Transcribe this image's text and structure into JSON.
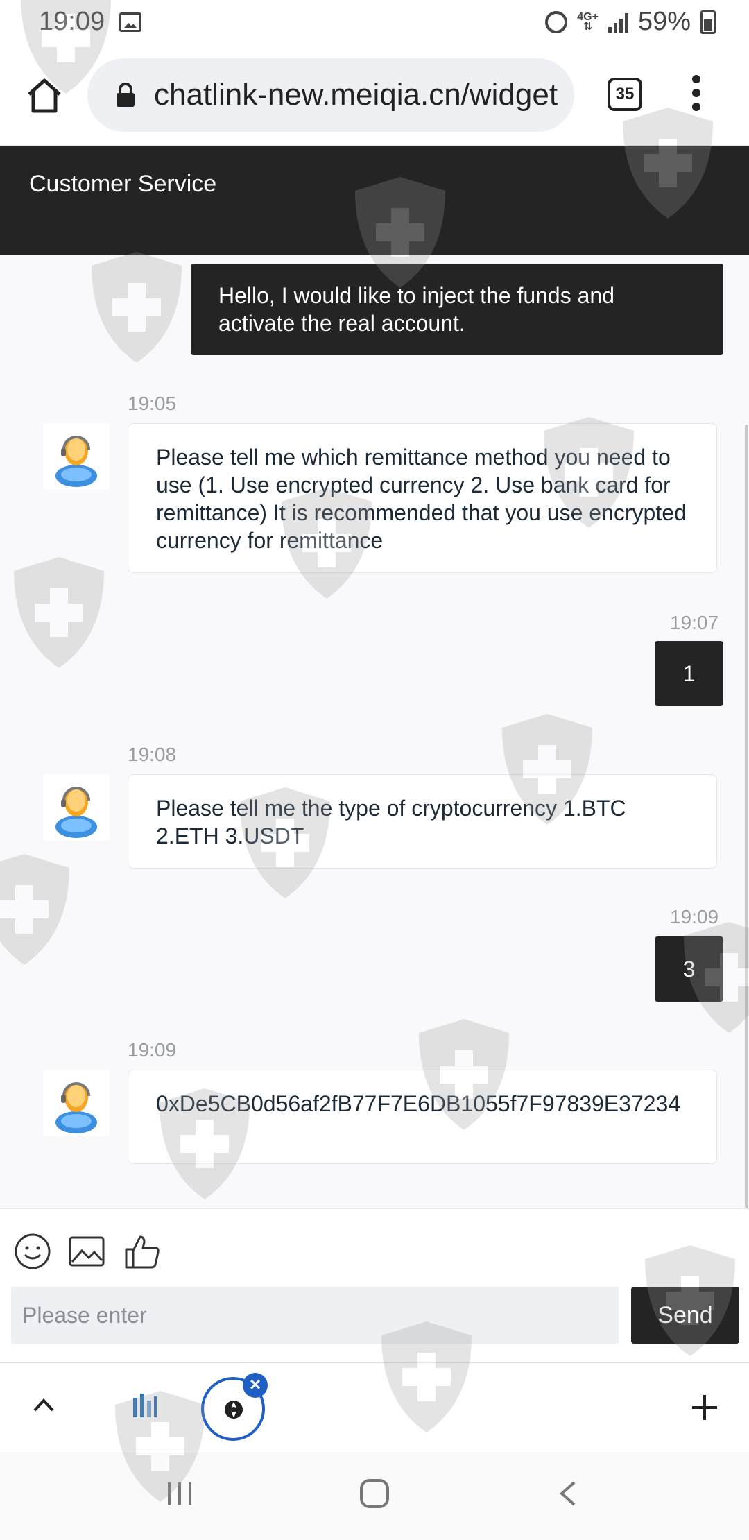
{
  "status_bar": {
    "time": "19:09",
    "network": "4G+",
    "battery": "59%",
    "icons": [
      "image-notification-icon",
      "alarm-icon",
      "signal-icon",
      "battery-icon"
    ]
  },
  "browser": {
    "url": "chatlink-new.meiqia.cn/widget",
    "tab_count": "35",
    "icons": [
      "home-icon",
      "lock-icon",
      "more-menu-icon"
    ]
  },
  "chat": {
    "title": "Customer Service",
    "messages": [
      {
        "from": "user",
        "time": "",
        "text": "Hello, I would like to inject the funds and activate the real account."
      },
      {
        "from": "agent",
        "time": "19:05",
        "text": "Please tell me which remittance method you need to use (1. Use encrypted currency 2. Use bank card for remittance) It is recommended that you use encrypted currency for remittance"
      },
      {
        "from": "user",
        "time": "19:07",
        "text": "1"
      },
      {
        "from": "agent",
        "time": "19:08",
        "text": "Please tell me the type of cryptocurrency 1.BTC 2.ETH 3.USDT"
      },
      {
        "from": "user",
        "time": "19:09",
        "text": "3"
      },
      {
        "from": "agent",
        "time": "19:09",
        "text": "0xDe5CB0d56af2fB77F7E6DB1055f7F97839E37234"
      }
    ]
  },
  "composer": {
    "tools": [
      "emoji-icon",
      "image-upload-icon",
      "thumbs-up-icon"
    ],
    "placeholder": "Please enter",
    "value": "",
    "send_label": "Send"
  },
  "bottom_bar": {
    "items": [
      "chevron-up-icon",
      "app-shortcut-icon",
      "floating-chat-icon",
      "close-badge-icon",
      "plus-icon"
    ]
  },
  "nav_bar": {
    "items": [
      "recent-apps-icon",
      "home-button-icon",
      "back-icon"
    ]
  },
  "colors": {
    "header_bg": "#242424",
    "user_bubble": "#242424",
    "agent_bubble": "#ffffff",
    "page_bg": "#f9f9fb",
    "accent_blue": "#1f5fc4"
  }
}
